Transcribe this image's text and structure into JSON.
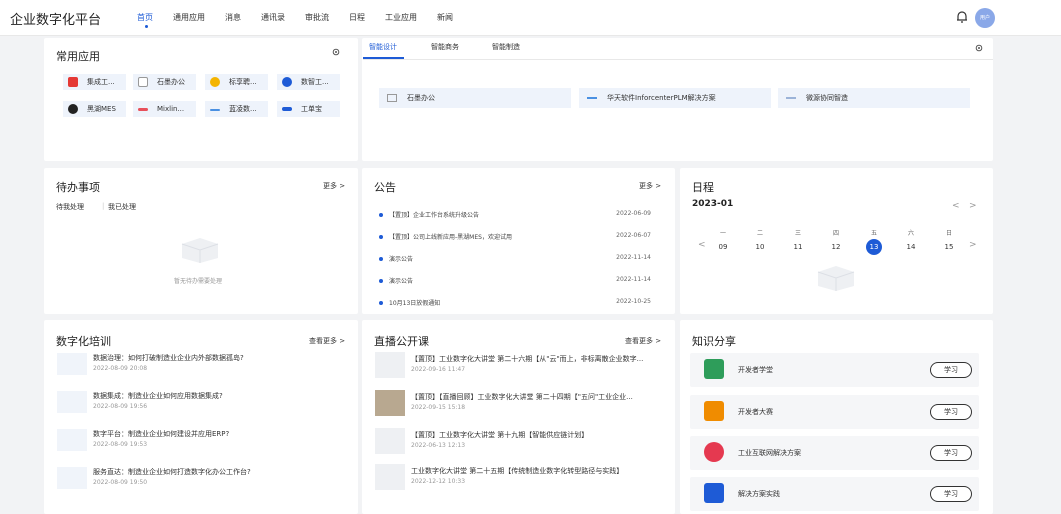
{
  "app_title": "企业数字化平台",
  "nav": [
    "首页",
    "通用应用",
    "消息",
    "通讯录",
    "审批流",
    "日程",
    "工业应用",
    "新闻"
  ],
  "avatar_text": "用户",
  "common_apps": {
    "title": "常用应用",
    "items": [
      {
        "label": "集成工...",
        "color": "#e53935"
      },
      {
        "label": "石墨办公",
        "color": "#ffffff"
      },
      {
        "label": "标享聘...",
        "color": "#f4b400"
      },
      {
        "label": "数智工...",
        "color": "#1e5bd6"
      },
      {
        "label": "黑湖MES",
        "color": "#222222"
      },
      {
        "label": "Mixlin...",
        "color": "#e8505b"
      },
      {
        "label": "蓝凌数...",
        "color": "#4a90e2"
      },
      {
        "label": "工单宝",
        "color": "#1e5bd6"
      }
    ]
  },
  "smart": {
    "tabs": [
      "智能设计",
      "智能商务",
      "智能制造"
    ],
    "solutions": [
      "石墨办公",
      "华天软件InforcenterPLM解决方案",
      "微源协同智造"
    ]
  },
  "todo": {
    "title": "待办事项",
    "more": "更多 >",
    "subtabs": [
      "待我处理",
      "我已处理"
    ],
    "empty_text": "暂无待办需要处理"
  },
  "notice": {
    "title": "公告",
    "more": "更多 >",
    "items": [
      {
        "text": "【置顶】企业工作台系统升级公告",
        "date": "2022-06-09"
      },
      {
        "text": "【置顶】公司上线新应用-黑湖MES，欢迎试用",
        "date": "2022-06-07"
      },
      {
        "text": "演示公告",
        "date": "2022-11-14"
      },
      {
        "text": "演示公告",
        "date": "2022-11-14"
      },
      {
        "text": "10月13日放假通知",
        "date": "2022-10-25"
      }
    ]
  },
  "schedule": {
    "title": "日程",
    "month": "2023-01",
    "weekdays": [
      "一",
      "二",
      "三",
      "四",
      "五",
      "六",
      "日"
    ],
    "days": [
      "09",
      "10",
      "11",
      "12",
      "13",
      "14",
      "15"
    ],
    "selected": "13"
  },
  "training": {
    "title": "数字化培训",
    "more": "查看更多 >",
    "items": [
      {
        "title": "数据治理：如何打破制造业企业内外部数据孤岛?",
        "date": "2022-08-09 20:08"
      },
      {
        "title": "数据集成：制造业企业如何应用数据集成?",
        "date": "2022-08-09 19:56"
      },
      {
        "title": "数字平台：制造业企业如何建设并应用ERP?",
        "date": "2022-08-09 19:53"
      },
      {
        "title": "服务直达：制造业企业如何打造数字化办公工作台?",
        "date": "2022-08-09 19:50"
      }
    ]
  },
  "live": {
    "title": "直播公开课",
    "more": "查看更多 >",
    "items": [
      {
        "title": "【置顶】工业数字化大讲堂 第二十六期【从\"云\"而上，非标离散企业数字...",
        "date": "2022-09-16 11:47"
      },
      {
        "title": "【置顶】【直播回顾】工业数字化大讲堂 第二十四期【\"五问\"工业企业...",
        "date": "2022-09-15 15:18"
      },
      {
        "title": "【置顶】工业数字化大讲堂 第十九期【智能供应链计划】",
        "date": "2022-06-13 12:13"
      },
      {
        "title": "工业数字化大讲堂 第二十五期【传统制造业数字化转型路径与实践】",
        "date": "2022-12-12 10:33"
      }
    ]
  },
  "knowledge": {
    "title": "知识分享",
    "items": [
      {
        "label": "开发者学堂",
        "button": "学习",
        "color": "#2e9d5a"
      },
      {
        "label": "开发者大赛",
        "button": "学习",
        "color": "#f08c00"
      },
      {
        "label": "工业互联网解决方案",
        "button": "学习",
        "color": "#e53950"
      },
      {
        "label": "解决方案实践",
        "button": "学习",
        "color": "#1e5bd6"
      }
    ]
  }
}
